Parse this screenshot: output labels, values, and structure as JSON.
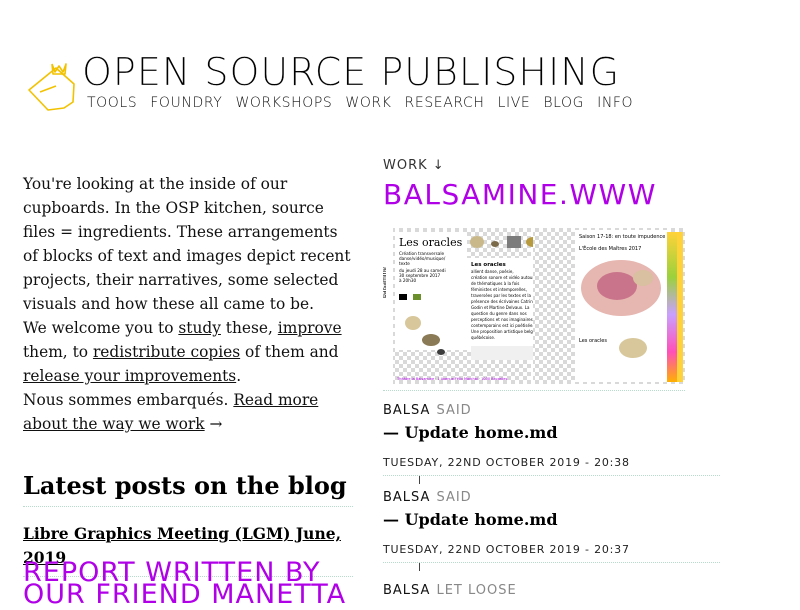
{
  "header": {
    "title": "OPEN SOURCE PUBLISHING",
    "nav": [
      "TOOLS",
      "FOUNDRY",
      "WORKSHOPS",
      "WORK",
      "RESEARCH",
      "LIVE",
      "BLOG",
      "INFO"
    ],
    "accent_color": "#f2c200"
  },
  "intro": {
    "p1": "You're looking at the inside of our cupboards. In the OSP kitchen, source files = ingredients. These arrangements of blocks of text and images depict recent projects, their narratives, some selected visuals and how these all came to be.",
    "p2_a": "We welcome you to ",
    "link_study": "study",
    "p2_b": " these, ",
    "link_improve": "improve",
    "p2_c": " them, to ",
    "link_redistribute": "redistribute copies",
    "p2_d": " of them and ",
    "link_release": "release your improvements",
    "p2_e": ".",
    "p3_a": "Nous sommes embarqués. ",
    "link_read_more": "Read more about the way we work",
    "arrow": " →"
  },
  "blog": {
    "heading": "Latest posts on the blog",
    "post_1": "Libre Graphics Meeting (LGM) June, 2019",
    "post_2": "REPORT WRITTEN BY OUR FRIEND MANETTA"
  },
  "work": {
    "label": "WORK ↓",
    "project_title": "BALSAMINE.WWW",
    "poster": {
      "title": "Les oracles",
      "subtitle": "Création transversale danse/vidéo/musique/texte",
      "dates": "du jeudi 28 au samedi 30 septembre 2017 à 20h30",
      "body": "Les oracles allient danse, poésie, création sonore et vidéo autour de thématiques à la fois féministes et intemporelles, traversées par les textes et la présence des écrivaines Catrine Godin et Martine Delvaux. La question du genre dans nos perceptions et nos imaginaires contemporains est ici poétisée. Une proposition artistique belgo-québécoise.",
      "season_title": "Saison 17-18: en toute impudence",
      "school_title": "L'École des Maîtres 2017",
      "side_title": "Les oracles"
    },
    "commits": [
      {
        "author": "BALSA",
        "verb": "SAID",
        "message": "— Update home.md",
        "date": "TUESDAY, 22ND OCTOBER 2019 - 20:38"
      },
      {
        "author": "BALSA",
        "verb": "SAID",
        "message": "— Update home.md",
        "date": "TUESDAY, 22ND OCTOBER 2019 - 20:37"
      },
      {
        "author": "BALSA",
        "verb": "LET LOOSE",
        "message": "",
        "date": ""
      }
    ]
  }
}
